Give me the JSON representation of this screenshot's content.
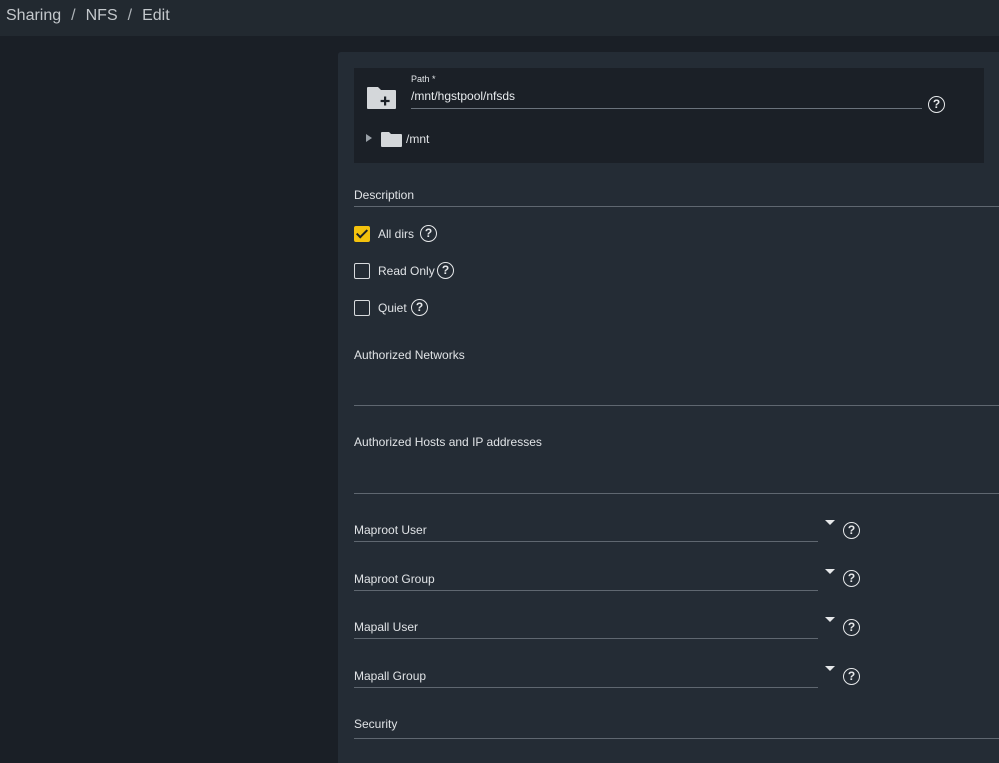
{
  "breadcrumb": {
    "items": [
      "Sharing",
      "NFS",
      "Edit"
    ],
    "separator": "/"
  },
  "explorer": {
    "path_label": "Path *",
    "path_value": "/mnt/hgstpool/nfsds",
    "tree_root": "/mnt",
    "icons": [
      "folder-add-icon",
      "folder-icon",
      "caret-right-icon",
      "help-icon"
    ]
  },
  "fields": {
    "description_label": "Description",
    "authorized_networks_label": "Authorized Networks",
    "authorized_hosts_label": "Authorized Hosts and IP addresses",
    "security_label": "Security"
  },
  "checkboxes": {
    "all_dirs": {
      "label": "All dirs",
      "checked": true
    },
    "read_only": {
      "label": "Read Only",
      "checked": false
    },
    "quiet": {
      "label": "Quiet",
      "checked": false
    }
  },
  "selects": {
    "maproot_user": "Maproot User",
    "maproot_group": "Maproot Group",
    "mapall_user": "Mapall User",
    "mapall_group": "Mapall Group"
  },
  "colors": {
    "accent": "#f4c20d",
    "card": "#242c35",
    "background": "#1a1f26",
    "topbar": "#222930"
  }
}
